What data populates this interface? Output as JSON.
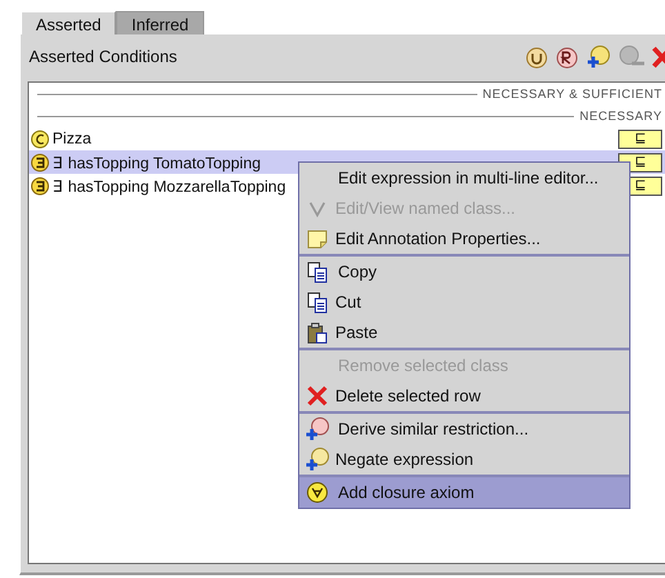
{
  "tabs": [
    {
      "label": "Asserted",
      "selected": true
    },
    {
      "label": "Inferred",
      "selected": false
    }
  ],
  "panel": {
    "title": "Asserted Conditions"
  },
  "sections": [
    {
      "label": "NECESSARY & SUFFICIENT"
    },
    {
      "label": "NECESSARY"
    }
  ],
  "conditions": [
    {
      "kind": "class",
      "text": "Pizza",
      "mark": "⊑",
      "selected": false
    },
    {
      "kind": "restriction",
      "text": "∃ hasTopping TomatoTopping",
      "mark": "⊑",
      "selected": true
    },
    {
      "kind": "restriction",
      "text": "∃ hasTopping MozzarellaTopping",
      "mark": "⊑",
      "selected": false
    }
  ],
  "context_menu": {
    "groups": [
      [
        {
          "label": "Edit expression in multi-line editor...",
          "disabled": false,
          "selected": false
        },
        {
          "label": "Edit/View named class...",
          "disabled": true,
          "selected": false
        },
        {
          "label": "Edit Annotation Properties...",
          "disabled": false,
          "selected": false
        }
      ],
      [
        {
          "label": "Copy",
          "disabled": false,
          "selected": false
        },
        {
          "label": "Cut",
          "disabled": false,
          "selected": false
        },
        {
          "label": "Paste",
          "disabled": false,
          "selected": false
        }
      ],
      [
        {
          "label": "Remove selected class",
          "disabled": true,
          "selected": false
        },
        {
          "label": "Delete selected row",
          "disabled": false,
          "selected": false
        }
      ],
      [
        {
          "label": "Derive similar restriction...",
          "disabled": false,
          "selected": false
        },
        {
          "label": "Negate expression",
          "disabled": false,
          "selected": false
        }
      ],
      [
        {
          "label": "Add closure axiom",
          "disabled": false,
          "selected": true
        }
      ]
    ]
  }
}
